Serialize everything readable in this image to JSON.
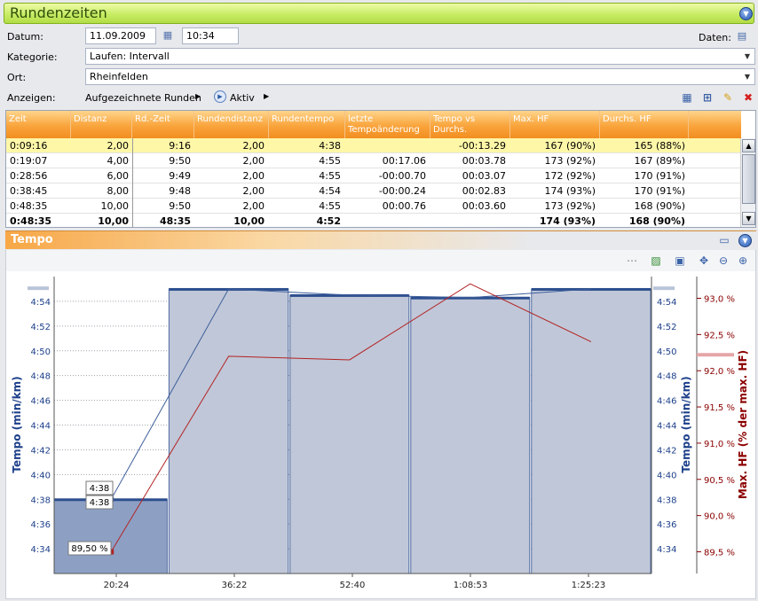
{
  "window": {
    "title": "Rundenzeiten"
  },
  "form": {
    "datum_label": "Datum:",
    "datum_value": "11.09.2009",
    "time_value": "10:34",
    "daten_label": "Daten:",
    "kategorie_label": "Kategorie:",
    "kategorie_value": "Laufen: Intervall",
    "ort_label": "Ort:",
    "ort_value": "Rheinfelden",
    "anzeigen_label": "Anzeigen:",
    "anzeigen_value": "Aufgezeichnete Runden",
    "aktiv_label": "Aktiv"
  },
  "table": {
    "headers": [
      "Zeit",
      "Distanz",
      "Rd.-Zeit",
      "Rundendistanz",
      "Rundentempo",
      "letzte Tempoänderung",
      "Tempo vs Durchs.",
      "Max. HF",
      "Durchs. HF"
    ],
    "rows": [
      [
        "0:09:16",
        "2,00",
        "9:16",
        "2,00",
        "4:38",
        "",
        "-00:13.29",
        "167 (90%)",
        "165 (88%)"
      ],
      [
        "0:19:07",
        "4,00",
        "9:50",
        "2,00",
        "4:55",
        "00:17.06",
        "00:03.78",
        "173 (92%)",
        "167 (89%)"
      ],
      [
        "0:28:56",
        "6,00",
        "9:49",
        "2,00",
        "4:55",
        "-00:00.70",
        "00:03.07",
        "172 (92%)",
        "170 (91%)"
      ],
      [
        "0:38:45",
        "8,00",
        "9:48",
        "2,00",
        "4:54",
        "-00:00.24",
        "00:02.83",
        "174 (93%)",
        "170 (91%)"
      ],
      [
        "0:48:35",
        "10,00",
        "9:50",
        "2,00",
        "4:55",
        "00:00.76",
        "00:03.60",
        "173 (92%)",
        "168 (90%)"
      ]
    ],
    "total": [
      "0:48:35",
      "10,00",
      "48:35",
      "10,00",
      "4:52",
      "",
      "",
      "174 (93%)",
      "168 (90%)"
    ]
  },
  "chart_panel": {
    "title": "Tempo"
  },
  "chart_data": {
    "type": "bar",
    "xlabel": "",
    "x_ticks": [
      "20:24",
      "36:22",
      "52:40",
      "1:08:53",
      "1:25:23"
    ],
    "ylabel_left": "Tempo (min/km)",
    "ylabel_right2": "Max. HF (% der max. HF)",
    "y_ticks": [
      "4:34",
      "4:36",
      "4:38",
      "4:40",
      "4:42",
      "4:44",
      "4:46",
      "4:48",
      "4:50",
      "4:52",
      "4:54"
    ],
    "y2_ticks": [
      "89,5 %",
      "90,0 %",
      "90,5 %",
      "91,0 %",
      "91,5 %",
      "92,0 %",
      "92,5 %",
      "93,0 %"
    ],
    "ylim_seconds": [
      272,
      296
    ],
    "y2lim": [
      89.2,
      93.3
    ],
    "laps": [
      {
        "start_sec": 0,
        "end_sec": 556,
        "pace": "4:38",
        "pace_sec": 278,
        "max_hf_pct": 89.5
      },
      {
        "start_sec": 556,
        "end_sec": 1147,
        "pace": "4:55",
        "pace_sec": 295,
        "max_hf_pct": 92.2
      },
      {
        "start_sec": 1147,
        "end_sec": 1736,
        "pace": "4:55",
        "pace_sec": 294.5,
        "max_hf_pct": 92.15
      },
      {
        "start_sec": 1736,
        "end_sec": 2325,
        "pace": "4:54",
        "pace_sec": 294.3,
        "max_hf_pct": 93.2
      },
      {
        "start_sec": 2325,
        "end_sec": 2915,
        "pace": "4:55",
        "pace_sec": 295,
        "max_hf_pct": 92.4
      }
    ],
    "tooltips": [
      "4:38",
      "4:38",
      "89,50 %"
    ],
    "colors": {
      "bar_first": "#8da0c4",
      "bar": "#c0c7d8",
      "pace_line": "#3d5e9a",
      "hf_line": "#b22222",
      "axis_blue": "#1c3f8a",
      "axis_red": "#8b0000"
    }
  }
}
